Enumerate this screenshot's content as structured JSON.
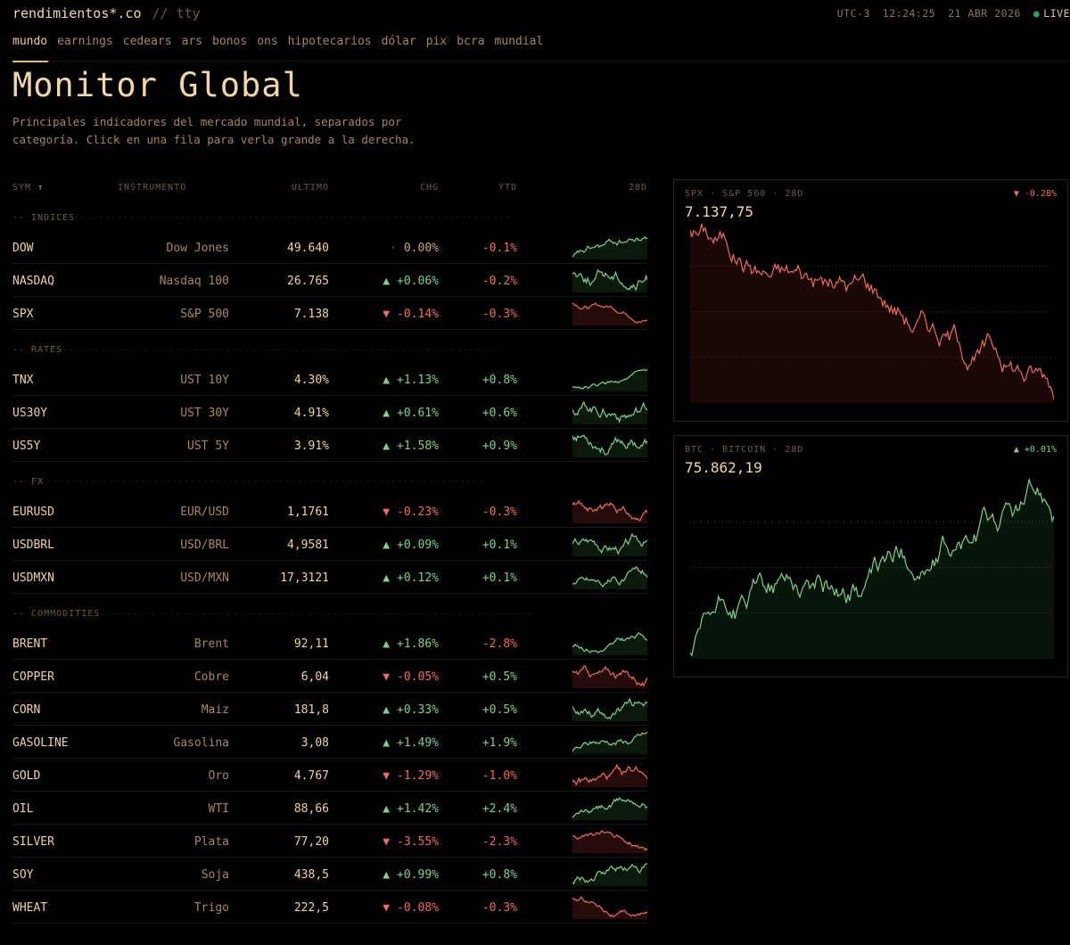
{
  "app": {
    "brand": "rendimientos*.co",
    "sep": "//",
    "sub": "tty"
  },
  "status": {
    "tz": "UTC-3",
    "time": "12:24:25",
    "date": "21 ABR 2026",
    "live": "LIVE",
    "dot": "●"
  },
  "nav": [
    "mundo",
    "earnings",
    "cedears",
    "ars",
    "bonos",
    "ons",
    "hipotecarios",
    "dólar",
    "pix",
    "bcra",
    "mundial"
  ],
  "page": {
    "title": "Monitor Global",
    "description": "Principales indicadores del mercado mundial, separados por categoría. Click en una fila para verla grande a la derecha."
  },
  "table": {
    "headers": {
      "sym": "SYM",
      "sort_icon": "↑",
      "inst": "INSTRUMENTO",
      "last": "ÚLTIMO",
      "chg": "CHG",
      "ytd": "YTD",
      "spark": "28D"
    }
  },
  "categories": [
    {
      "label": "-- INDICES",
      "rows": [
        {
          "sym": "DOW",
          "name": "Dow Jones",
          "last": "49.640",
          "arrow": "·",
          "chg": "0.00%",
          "ytd": "-0.1%",
          "dir": "flat",
          "ytd_dir": "down",
          "spark": "up"
        },
        {
          "sym": "NASDAQ",
          "name": "Nasdaq 100",
          "last": "26.765",
          "arrow": "▲",
          "chg": "+0.06%",
          "ytd": "-0.2%",
          "dir": "up",
          "ytd_dir": "down",
          "spark": "up"
        },
        {
          "sym": "SPX",
          "name": "S&P 500",
          "last": "7.138",
          "arrow": "▼",
          "chg": "-0.14%",
          "ytd": "-0.3%",
          "dir": "down",
          "ytd_dir": "down",
          "spark": "down"
        }
      ]
    },
    {
      "label": "-- RATES",
      "rows": [
        {
          "sym": "TNX",
          "name": "UST 10Y",
          "last": "4.30%",
          "arrow": "▲",
          "chg": "+1.13%",
          "ytd": "+0.8%",
          "dir": "up",
          "ytd_dir": "up",
          "spark": "up"
        },
        {
          "sym": "US30Y",
          "name": "UST 30Y",
          "last": "4.91%",
          "arrow": "▲",
          "chg": "+0.61%",
          "ytd": "+0.6%",
          "dir": "up",
          "ytd_dir": "up",
          "spark": "up"
        },
        {
          "sym": "US5Y",
          "name": "UST 5Y",
          "last": "3.91%",
          "arrow": "▲",
          "chg": "+1.58%",
          "ytd": "+0.9%",
          "dir": "up",
          "ytd_dir": "up",
          "spark": "up"
        }
      ]
    },
    {
      "label": "-- FX",
      "rows": [
        {
          "sym": "EURUSD",
          "name": "EUR/USD",
          "last": "1,1761",
          "arrow": "▼",
          "chg": "-0.23%",
          "ytd": "-0.3%",
          "dir": "down",
          "ytd_dir": "down",
          "spark": "down"
        },
        {
          "sym": "USDBRL",
          "name": "USD/BRL",
          "last": "4,9581",
          "arrow": "▲",
          "chg": "+0.09%",
          "ytd": "+0.1%",
          "dir": "up",
          "ytd_dir": "up",
          "spark": "up"
        },
        {
          "sym": "USDMXN",
          "name": "USD/MXN",
          "last": "17,3121",
          "arrow": "▲",
          "chg": "+0.12%",
          "ytd": "+0.1%",
          "dir": "up",
          "ytd_dir": "up",
          "spark": "up"
        }
      ]
    },
    {
      "label": "-- COMMODITIES",
      "rows": [
        {
          "sym": "BRENT",
          "name": "Brent",
          "last": "92,11",
          "arrow": "▲",
          "chg": "+1.86%",
          "ytd": "-2.8%",
          "dir": "up",
          "ytd_dir": "down",
          "spark": "up"
        },
        {
          "sym": "COPPER",
          "name": "Cobre",
          "last": "6,04",
          "arrow": "▼",
          "chg": "-0.05%",
          "ytd": "+0.5%",
          "dir": "down",
          "ytd_dir": "up",
          "spark": "down"
        },
        {
          "sym": "CORN",
          "name": "Maiz",
          "last": "181,8",
          "arrow": "▲",
          "chg": "+0.33%",
          "ytd": "+0.5%",
          "dir": "up",
          "ytd_dir": "up",
          "spark": "up"
        },
        {
          "sym": "GASOLINE",
          "name": "Gasolina",
          "last": "3,08",
          "arrow": "▲",
          "chg": "+1.49%",
          "ytd": "+1.9%",
          "dir": "up",
          "ytd_dir": "up",
          "spark": "up"
        },
        {
          "sym": "GOLD",
          "name": "Oro",
          "last": "4.767",
          "arrow": "▼",
          "chg": "-1.29%",
          "ytd": "-1.0%",
          "dir": "down",
          "ytd_dir": "down",
          "spark": "down"
        },
        {
          "sym": "OIL",
          "name": "WTI",
          "last": "88,66",
          "arrow": "▲",
          "chg": "+1.42%",
          "ytd": "+2.4%",
          "dir": "up",
          "ytd_dir": "up",
          "spark": "up"
        },
        {
          "sym": "SILVER",
          "name": "Plata",
          "last": "77,20",
          "arrow": "▼",
          "chg": "-3.55%",
          "ytd": "-2.3%",
          "dir": "down",
          "ytd_dir": "down",
          "spark": "down"
        },
        {
          "sym": "SOY",
          "name": "Soja",
          "last": "438,5",
          "arrow": "▲",
          "chg": "+0.99%",
          "ytd": "+0.8%",
          "dir": "up",
          "ytd_dir": "up",
          "spark": "up"
        },
        {
          "sym": "WHEAT",
          "name": "Trigo",
          "last": "222,5",
          "arrow": "▼",
          "chg": "-0.08%",
          "ytd": "-0.3%",
          "dir": "down",
          "ytd_dir": "down",
          "spark": "down"
        }
      ]
    }
  ],
  "panels": [
    {
      "title": "SPX · S&P 500 · 28D",
      "value": "7.137,75",
      "arrow": "▼",
      "chg": "-0.28%",
      "dir": "down"
    },
    {
      "title": "BTC · BITCOIN · 28D",
      "value": "75.862,19",
      "arrow": "▲",
      "chg": "+0.01%",
      "dir": "up"
    }
  ],
  "colors": {
    "up": "#7fd18c",
    "down": "#ee6d5e",
    "accent": "#f3d6a6",
    "muted": "#a88664"
  }
}
